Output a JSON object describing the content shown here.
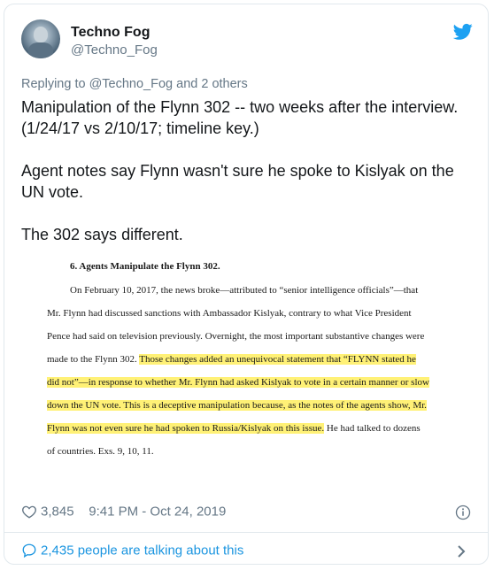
{
  "author": {
    "display_name": "Techno Fog",
    "handle": "@Techno_Fog"
  },
  "replying": {
    "prefix": "Replying to",
    "target": "@Techno_Fog",
    "suffix": "and 2 others"
  },
  "tweet": {
    "line1": "Manipulation of the Flynn 302 -- two weeks after the interview. (1/24/17 vs 2/10/17; timeline key.)",
    "line2": "Agent notes say Flynn wasn't sure he spoke to Kislyak on the UN vote.",
    "line3": "The 302 says different."
  },
  "document": {
    "heading": "6. Agents Manipulate the Flynn 302.",
    "lines": [
      {
        "plain": "On February 10, 2017, the news broke—attributed to “senior intelligence officials”—that",
        "hl": "",
        "tail": ""
      },
      {
        "plain": "Mr. Flynn had discussed sanctions with Ambassador Kislyak, contrary to what Vice President",
        "hl": "",
        "tail": ""
      },
      {
        "plain": "Pence had said on television previously.  Overnight, the most important substantive changes were",
        "hl": "",
        "tail": ""
      },
      {
        "plain": "made to the Flynn 302.  ",
        "hl": "Those changes added an unequivocal statement that “FLYNN stated he",
        "tail": ""
      },
      {
        "plain": "",
        "hl": "did not”—in response to whether Mr. Flynn had asked Kislyak to vote in a certain manner or slow",
        "tail": ""
      },
      {
        "plain": "",
        "hl": "down the UN vote.  This is a deceptive manipulation because, as the notes of the agents show, Mr.",
        "tail": ""
      },
      {
        "plain": "",
        "hl": "Flynn was not even sure he had spoken to Russia/Kislyak on this issue.",
        "tail": "  He had talked to dozens"
      },
      {
        "plain": "of countries.  Exs. 9, 10, 11.",
        "hl": "",
        "tail": ""
      }
    ]
  },
  "meta": {
    "likes": "3,845",
    "timestamp": "9:41 PM - Oct 24, 2019"
  },
  "talking": {
    "label": "2,435 people are talking about this"
  },
  "colors": {
    "accent": "#1b95e0",
    "muted": "#657786",
    "highlight": "#fff176"
  },
  "icons": [
    "twitter-bird-icon",
    "heart-icon",
    "info-icon",
    "speech-bubble-icon",
    "chevron-right-icon"
  ]
}
